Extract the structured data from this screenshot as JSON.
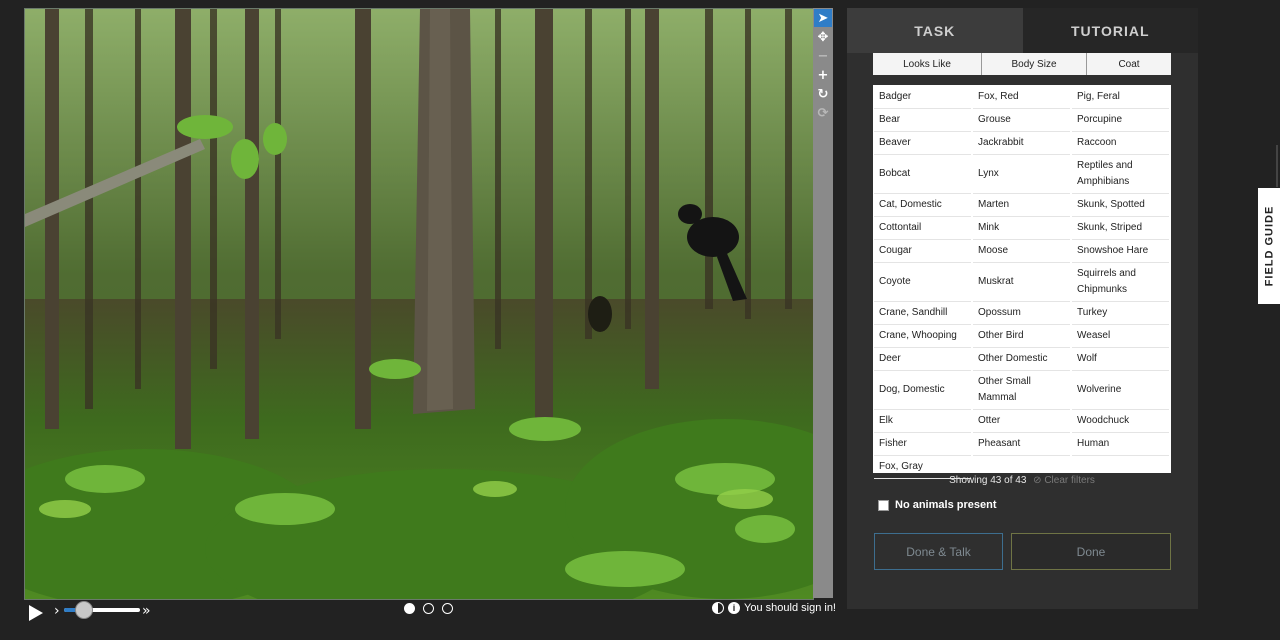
{
  "viewer": {
    "tools": [
      {
        "name": "pointer-tool",
        "icon": "cursor-arrow-icon",
        "glyph": "➤",
        "active": true
      },
      {
        "name": "move-tool",
        "icon": "move-arrows-icon",
        "glyph": "✥",
        "active": false
      },
      {
        "name": "zoom-out-tool",
        "icon": "minus-icon",
        "glyph": "−",
        "active": false,
        "disabled": true
      },
      {
        "name": "zoom-in-tool",
        "icon": "plus-icon",
        "glyph": "+",
        "active": false
      },
      {
        "name": "rotate-tool",
        "icon": "rotate-icon",
        "glyph": "↻",
        "active": false
      },
      {
        "name": "reset-tool",
        "icon": "reset-icon",
        "glyph": "⟳",
        "active": false,
        "disabled": true
      }
    ],
    "playback": {
      "speed_down": "›",
      "speed_up": "»",
      "slider_level": 0.25
    },
    "frames": {
      "count": 3,
      "current": 0
    },
    "signin_text": "You should sign in!"
  },
  "panel": {
    "tabs": [
      {
        "label": "TASK",
        "active": true
      },
      {
        "label": "TUTORIAL",
        "active": false
      }
    ],
    "filters": [
      "Looks Like",
      "Body Size",
      "Coat"
    ],
    "species_columns": [
      [
        "Badger",
        "Bear",
        "Beaver",
        "Bobcat",
        "Cat, Domestic",
        "Cottontail",
        "Cougar",
        "Coyote",
        "Crane, Sandhill",
        "Crane, Whooping",
        "Deer",
        "Dog, Domestic",
        "Elk",
        "Fisher",
        "Fox, Gray"
      ],
      [
        "Fox, Red",
        "Grouse",
        "Jackrabbit",
        "Lynx",
        "Marten",
        "Mink",
        "Moose",
        "Muskrat",
        "Opossum",
        "Other Bird",
        "Other Domestic",
        "Other Small Mammal",
        "Otter",
        "Pheasant"
      ],
      [
        "Pig, Feral",
        "Porcupine",
        "Raccoon",
        "Reptiles and Amphibians",
        "Skunk, Spotted",
        "Skunk, Striped",
        "Snowshoe Hare",
        "Squirrels and Chipmunks",
        "Turkey",
        "Weasel",
        "Wolf",
        "Wolverine",
        "Woodchuck",
        "Human"
      ]
    ],
    "tall_rows": [
      3,
      7,
      11
    ],
    "showing_text": "Showing 43 of 43",
    "clear_filters": "Clear filters",
    "no_animals_label": "No animals present",
    "done_talk_label": "Done & Talk",
    "done_label": "Done"
  },
  "field_guide_label": "FIELD GUIDE",
  "colors": {
    "accent": "#2f7dc7",
    "panel_bg": "#2f2f2f",
    "page_bg": "#222222"
  }
}
